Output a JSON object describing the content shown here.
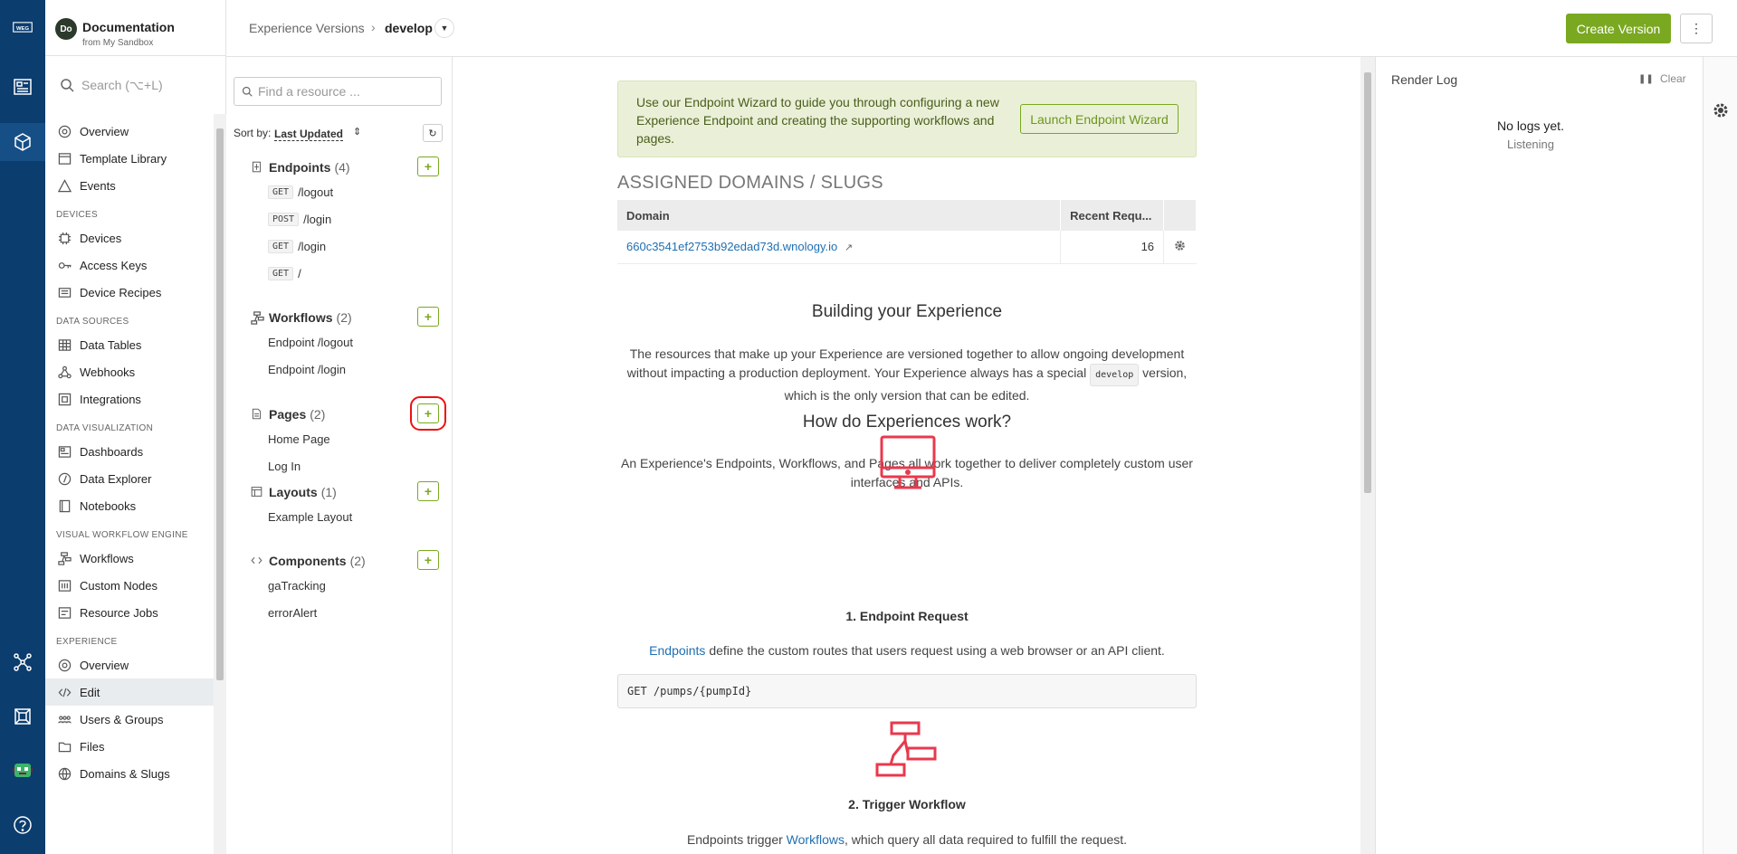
{
  "rail": {
    "items": [
      "logo-icon",
      "dashboard-icon",
      "experience-cube-icon",
      "workflow-network-icon",
      "device-icon",
      "avatar-icon",
      "help-icon"
    ],
    "logo_text": "WEG"
  },
  "org": {
    "avatar_initials": "Do",
    "name": "Documentation",
    "subtitle": "from My Sandbox"
  },
  "search": {
    "placeholder": "Search (⌥+L)"
  },
  "sidebar": {
    "top_items": [
      {
        "label": "Overview",
        "icon": "overview-icon"
      },
      {
        "label": "Template Library",
        "icon": "template-icon"
      },
      {
        "label": "Events",
        "icon": "warning-icon"
      }
    ],
    "sections": [
      {
        "title": "DEVICES",
        "items": [
          {
            "label": "Devices",
            "icon": "chip-icon"
          },
          {
            "label": "Access Keys",
            "icon": "key-icon"
          },
          {
            "label": "Device Recipes",
            "icon": "recipe-icon"
          }
        ]
      },
      {
        "title": "DATA SOURCES",
        "items": [
          {
            "label": "Data Tables",
            "icon": "table-icon"
          },
          {
            "label": "Webhooks",
            "icon": "webhook-icon"
          },
          {
            "label": "Integrations",
            "icon": "integration-icon"
          }
        ]
      },
      {
        "title": "DATA VISUALIZATION",
        "items": [
          {
            "label": "Dashboards",
            "icon": "dashboard-icon"
          },
          {
            "label": "Data Explorer",
            "icon": "compass-icon"
          },
          {
            "label": "Notebooks",
            "icon": "notebook-icon"
          }
        ]
      },
      {
        "title": "VISUAL WORKFLOW ENGINE",
        "items": [
          {
            "label": "Workflows",
            "icon": "workflow-icon"
          },
          {
            "label": "Custom Nodes",
            "icon": "custom-node-icon"
          },
          {
            "label": "Resource Jobs",
            "icon": "job-icon"
          }
        ]
      },
      {
        "title": "EXPERIENCE",
        "items": [
          {
            "label": "Overview",
            "icon": "overview-icon"
          },
          {
            "label": "Edit",
            "icon": "code-icon"
          },
          {
            "label": "Users & Groups",
            "icon": "users-icon"
          },
          {
            "label": "Files",
            "icon": "folder-icon"
          },
          {
            "label": "Domains & Slugs",
            "icon": "globe-icon"
          }
        ]
      }
    ],
    "selected": "Edit"
  },
  "header": {
    "breadcrumb_root": "Experience Versions",
    "breadcrumb_sep": "›",
    "breadcrumb_current": "develop",
    "create_label": "Create Version",
    "more_label": "⋮"
  },
  "resources": {
    "search_placeholder": "Find a resource ...",
    "sort_label": "Sort by:",
    "sort_value": "Last Updated",
    "groups": [
      {
        "name": "Endpoints",
        "count": "(4)",
        "icon": "endpoint-icon",
        "items": [
          {
            "method": "GET",
            "label": "/logout"
          },
          {
            "method": "POST",
            "label": "/login"
          },
          {
            "method": "GET",
            "label": "/login"
          },
          {
            "method": "GET",
            "label": "/"
          }
        ]
      },
      {
        "name": "Workflows",
        "count": "(2)",
        "icon": "workflow-icon",
        "items": [
          {
            "label": "Endpoint /logout"
          },
          {
            "label": "Endpoint /login"
          }
        ]
      },
      {
        "name": "Pages",
        "count": "(2)",
        "icon": "page-icon",
        "items": [
          {
            "label": "Home Page"
          },
          {
            "label": "Log In"
          }
        ]
      },
      {
        "name": "Layouts",
        "count": "(1)",
        "icon": "layout-icon",
        "items": [
          {
            "label": "Example Layout"
          }
        ]
      },
      {
        "name": "Components",
        "count": "(2)",
        "icon": "component-icon",
        "items": [
          {
            "label": "gaTracking"
          },
          {
            "label": "errorAlert"
          }
        ]
      }
    ],
    "add_label": "+"
  },
  "main": {
    "wizard_text": "Use our Endpoint Wizard to guide you through configuring a new Experience Endpoint and creating the supporting workflows and pages.",
    "wizard_button": "Launch Endpoint Wizard",
    "domains_title": "ASSIGNED DOMAINS / SLUGS",
    "domains_headers": [
      "Domain",
      "Recent Requ..."
    ],
    "domains_rows": [
      {
        "domain": "660c3541ef2753b92edad73d.wnology.io",
        "requests": "16"
      }
    ],
    "building_title": "Building your Experience",
    "building_text_1": "The resources that make up your Experience are versioned together to allow ongoing development without impacting a production deployment. Your Experience always has a special",
    "building_code": "develop",
    "building_text_2": "version, which is the only version that can be edited.",
    "how_title": "How do Experiences work?",
    "how_text": "An Experience's Endpoints, Workflows, and Pages all work together to deliver completely custom user interfaces and APIs.",
    "step1_title": "1. Endpoint Request",
    "step1_link": "Endpoints",
    "step1_text": "define the custom routes that users request using a web browser or an API client.",
    "step1_code": "GET /pumps/{pumpId}",
    "step2_title": "2. Trigger Workflow",
    "step2_prefix": "Endpoints trigger",
    "step2_link": "Workflows",
    "step2_suffix": ", which query all data required to fulfill the request.",
    "accent_color": "#e8394d"
  },
  "render_log": {
    "title": "Render Log",
    "pause": "❚❚",
    "clear": "Clear",
    "empty": "No logs yet.",
    "status": "Listening"
  }
}
